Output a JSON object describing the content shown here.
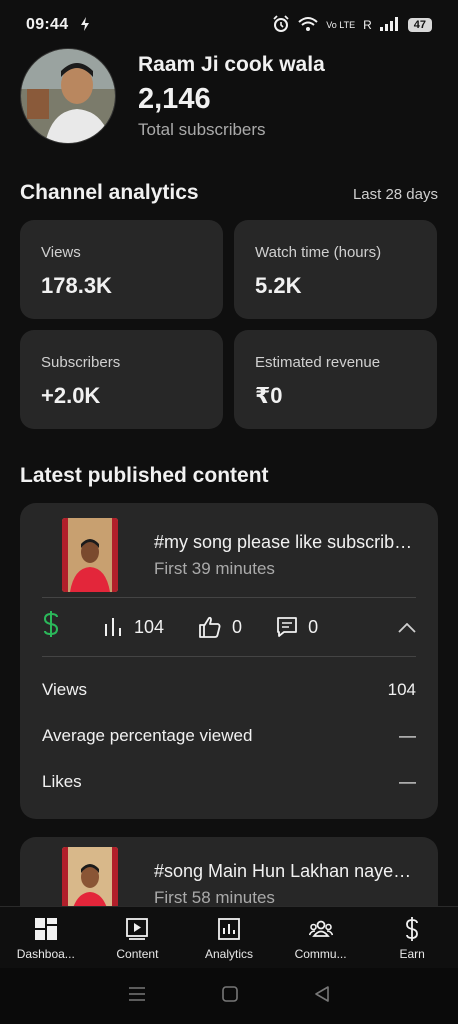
{
  "status_bar": {
    "time": "09:44",
    "network_label": "Vo LTE",
    "signal_label": "R",
    "battery": "47"
  },
  "channel": {
    "name": "Raam Ji cook wala",
    "subscriber_count": "2,146",
    "subscriber_label": "Total subscribers"
  },
  "analytics": {
    "title": "Channel analytics",
    "range": "Last 28 days",
    "metrics": [
      {
        "label": "Views",
        "value": "178.3K"
      },
      {
        "label": "Watch time (hours)",
        "value": "5.2K"
      },
      {
        "label": "Subscribers",
        "value": "+2.0K"
      },
      {
        "label": "Estimated revenue",
        "value": "₹0"
      }
    ]
  },
  "latest": {
    "title": "Latest published content",
    "videos": [
      {
        "title": "#my song please like subscribe...",
        "age": "First 39 minutes",
        "views": "104",
        "likes": "0",
        "comments": "0",
        "details": [
          {
            "label": "Views",
            "value": "104"
          },
          {
            "label": "Average percentage viewed",
            "value": "—"
          },
          {
            "label": "Likes",
            "value": "—"
          }
        ]
      },
      {
        "title": "#song Main Hun Lakhan naye j...",
        "age": "First 58 minutes"
      }
    ]
  },
  "bottom_nav": [
    {
      "label": "Dashboa...",
      "icon": "dashboard-icon"
    },
    {
      "label": "Content",
      "icon": "content-icon"
    },
    {
      "label": "Analytics",
      "icon": "analytics-icon"
    },
    {
      "label": "Commu...",
      "icon": "community-icon"
    },
    {
      "label": "Earn",
      "icon": "earn-icon"
    }
  ],
  "colors": {
    "background": "#0f0f0f",
    "card": "#272727",
    "revenue_green": "#2bb85a"
  }
}
